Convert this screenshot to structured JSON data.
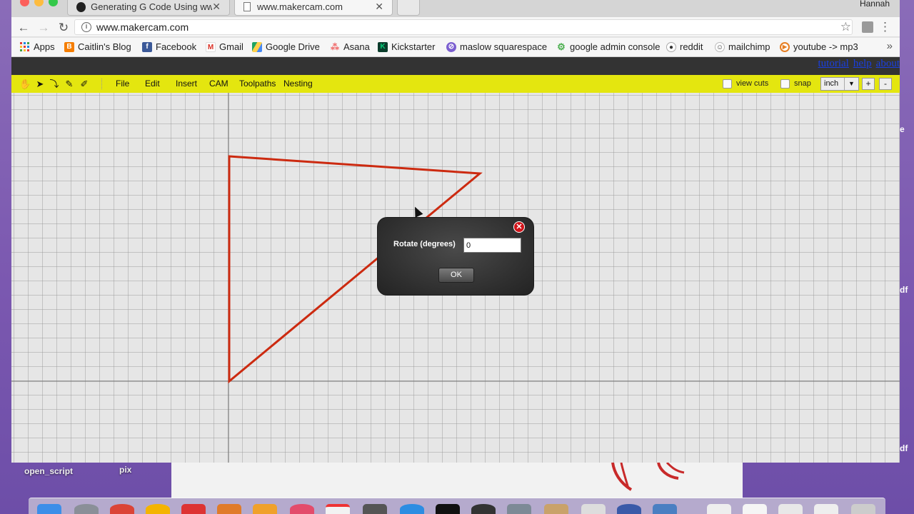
{
  "browser": {
    "tabs": [
      {
        "title": "Generating G Code Using www",
        "active": false,
        "icon": "github-icon"
      },
      {
        "title": "www.makercam.com",
        "active": true,
        "icon": "page-icon"
      }
    ],
    "user": "Hannah",
    "url": "www.makercam.com",
    "bookmarks": [
      {
        "label": "Apps",
        "icon": "apps-grid-icon"
      },
      {
        "label": "Caitlin's Blog",
        "icon": "blogger-icon",
        "color": "#f57d00"
      },
      {
        "label": "Facebook",
        "icon": "facebook-icon",
        "color": "#3b5998"
      },
      {
        "label": "Gmail",
        "icon": "gmail-icon",
        "color": "#d93025"
      },
      {
        "label": "Google Drive",
        "icon": "drive-icon",
        "color": "#1fa463"
      },
      {
        "label": "Asana",
        "icon": "asana-icon",
        "color": "#f06a6a"
      },
      {
        "label": "Kickstarter",
        "icon": "kickstarter-icon",
        "color": "#05ce78"
      },
      {
        "label": "maslow squarespace",
        "icon": "squarespace-icon",
        "color": "#7b5fd0"
      },
      {
        "label": "google admin console",
        "icon": "admin-gear-icon",
        "color": "#4caf50"
      },
      {
        "label": "reddit",
        "icon": "reddit-icon",
        "color": "#ff4500"
      },
      {
        "label": "mailchimp",
        "icon": "mailchimp-icon",
        "color": "#333"
      },
      {
        "label": "youtube -> mp3",
        "icon": "youtube-mp3-icon",
        "color": "#e67e22"
      }
    ]
  },
  "page": {
    "links": [
      "tutorial",
      "help",
      "about"
    ],
    "menus": [
      "File",
      "Edit",
      "Insert",
      "CAM",
      "Toolpaths",
      "Nesting"
    ],
    "view_cuts_label": "view cuts",
    "snap_label": "snap",
    "unit": "inch",
    "zoom_in": "+",
    "zoom_out": "-",
    "toolbar_color": "#e4e60f",
    "shape_color": "#cc2a10"
  },
  "dialog": {
    "label": "Rotate (degrees)",
    "value": "0",
    "ok_label": "OK"
  },
  "desktop": {
    "labels": [
      "open_script",
      "pix"
    ],
    "right_fragments": [
      "e",
      "df",
      "df"
    ]
  }
}
